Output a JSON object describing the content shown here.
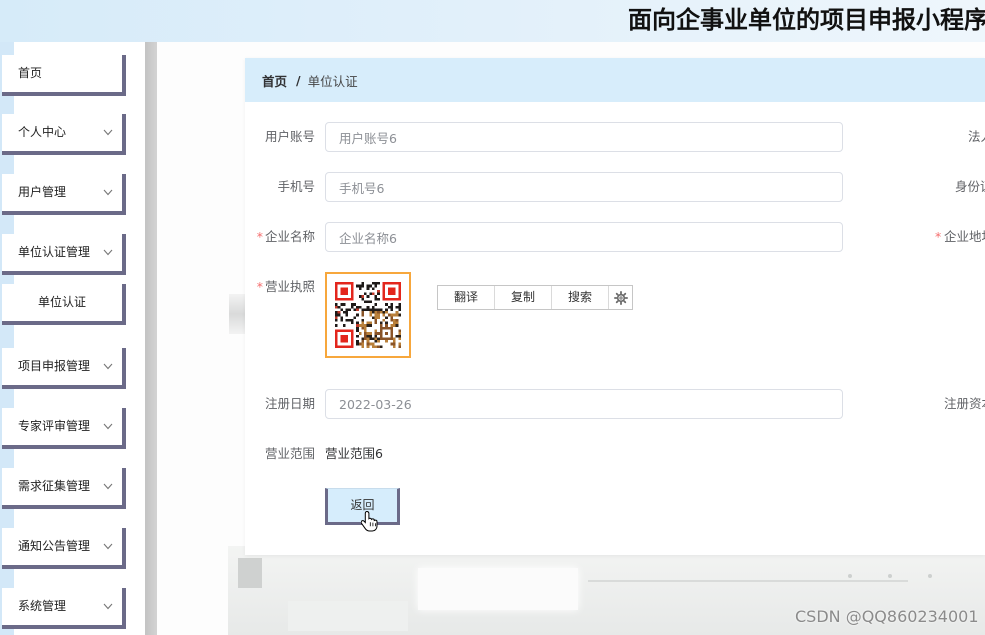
{
  "header": {
    "title": "面向企事业单位的项目申报小程序"
  },
  "sidebar": {
    "items": [
      {
        "label": "首页"
      },
      {
        "label": "个人中心",
        "icon": "chevron-down-icon"
      },
      {
        "label": "用户管理",
        "icon": "chevron-down-icon"
      },
      {
        "label": "单位认证管理",
        "icon": "chevron-down-icon"
      },
      {
        "label": "单位认证"
      },
      {
        "label": "项目申报管理",
        "icon": "chevron-down-icon"
      },
      {
        "label": "专家评审管理",
        "icon": "chevron-down-icon"
      },
      {
        "label": "需求征集管理",
        "icon": "chevron-down-icon"
      },
      {
        "label": "通知公告管理",
        "icon": "chevron-down-icon"
      },
      {
        "label": "系统管理",
        "icon": "chevron-down-icon"
      }
    ]
  },
  "breadcrumb": {
    "home": "首页",
    "separator": "/",
    "current": "单位认证"
  },
  "form": {
    "required_mark": "*",
    "account": {
      "label": "用户账号",
      "value": "用户账号6"
    },
    "phone": {
      "label": "手机号",
      "value": "手机号6"
    },
    "company_name": {
      "label": "企业名称",
      "value": "企业名称6",
      "required": true
    },
    "business_license": {
      "label": "营业执照",
      "required": true
    },
    "registration_date": {
      "label": "注册日期",
      "value": "2022-03-26"
    },
    "business_scope": {
      "label": "营业范围",
      "value": "营业范围6"
    },
    "legal_person": {
      "label": "法人"
    },
    "id_card": {
      "label": "身份证"
    },
    "company_address": {
      "label": "企业地址",
      "required": true
    },
    "registered_capital": {
      "label": "注册资本"
    }
  },
  "selection_toolbar": {
    "translate": "翻译",
    "copy": "复制",
    "search": "搜索",
    "settings_icon": "gear-icon"
  },
  "actions": {
    "back": "返回"
  },
  "cursor_icon": "hand-pointer-icon",
  "watermark": "CSDN @QQ860234001",
  "colors": {
    "header_bg": "#d6ebf9",
    "breadcrumb_bg": "#d7edfb",
    "menu_border": "#6b6a88",
    "required": "#f56c6c",
    "license_border": "#f7a73c",
    "button_bg": "#d6edfc"
  }
}
